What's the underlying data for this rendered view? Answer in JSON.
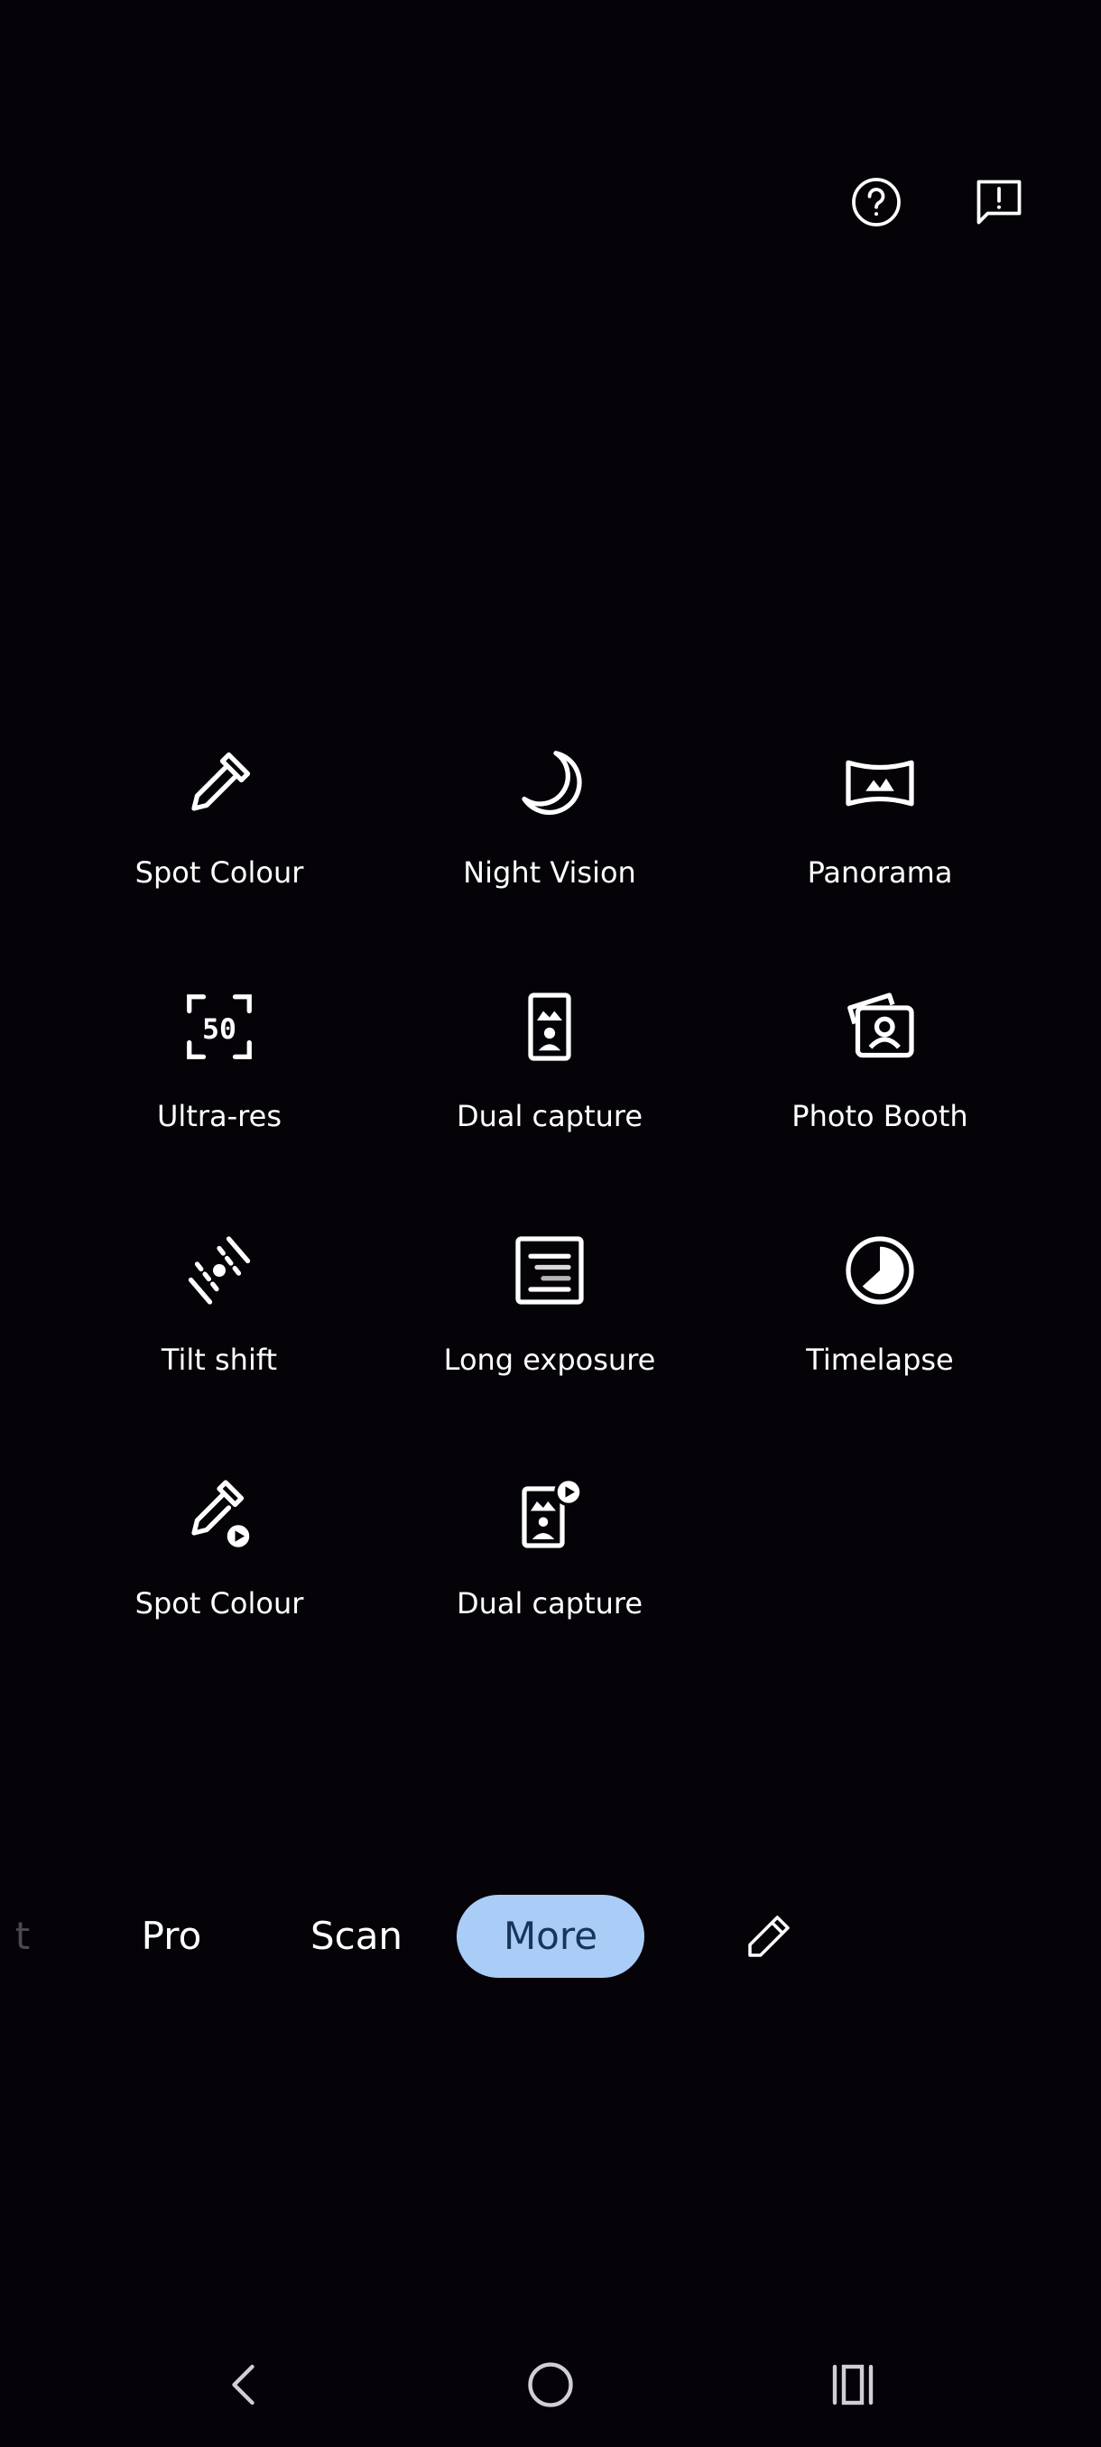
{
  "header": {
    "help_icon": "help-circle-icon",
    "feedback_icon": "feedback-icon"
  },
  "modes": [
    {
      "label": "Spot Colour",
      "icon": "eyedropper-icon"
    },
    {
      "label": "Night Vision",
      "icon": "moon-icon"
    },
    {
      "label": "Panorama",
      "icon": "panorama-icon"
    },
    {
      "label": "Ultra-res",
      "icon": "ultra-res-50-icon"
    },
    {
      "label": "Dual capture",
      "icon": "dual-capture-icon"
    },
    {
      "label": "Photo Booth",
      "icon": "photo-booth-icon"
    },
    {
      "label": "Tilt shift",
      "icon": "tilt-shift-icon"
    },
    {
      "label": "Long exposure",
      "icon": "long-exposure-icon"
    },
    {
      "label": "Timelapse",
      "icon": "timelapse-icon"
    },
    {
      "label": "Spot Colour",
      "icon": "eyedropper-video-icon"
    },
    {
      "label": "Dual capture",
      "icon": "dual-capture-video-icon"
    }
  ],
  "mode_bar": {
    "partial_label": "t",
    "tabs": [
      "Pro",
      "Scan",
      "More"
    ],
    "selected": "More",
    "edit_icon": "pencil-icon"
  },
  "colors": {
    "background": "#050308",
    "selected_pill": "#a9cdf7",
    "selected_text": "#17355a"
  },
  "navigation": {
    "back_icon": "back-chevron-icon",
    "home_icon": "home-circle-icon",
    "recents_icon": "recents-icon"
  }
}
